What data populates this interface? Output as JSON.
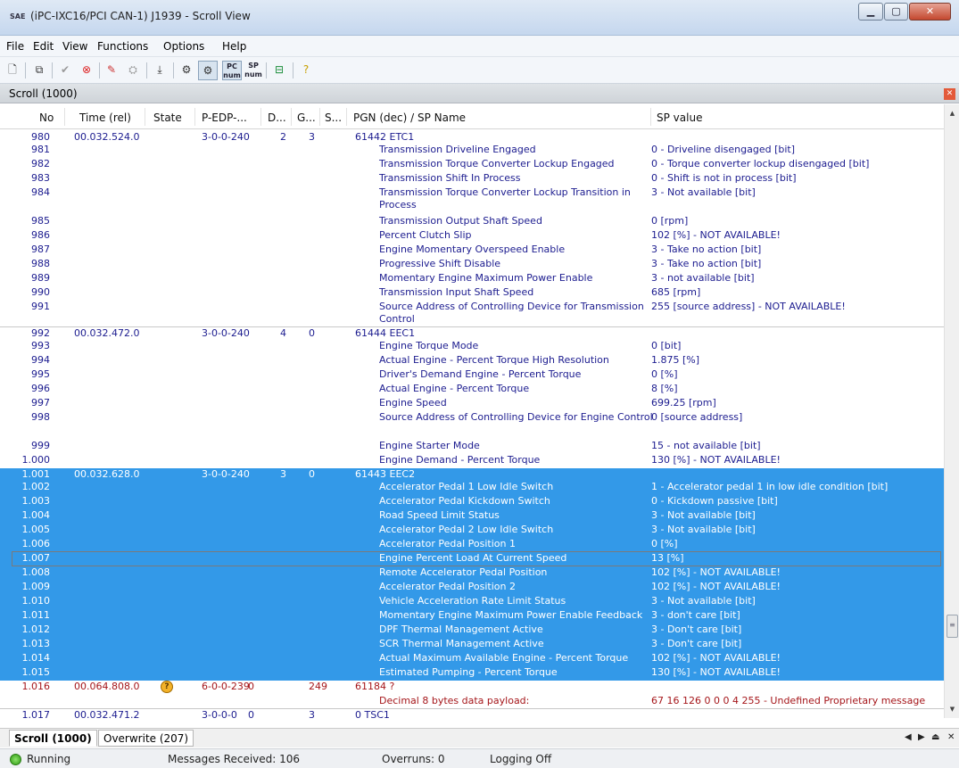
{
  "window": {
    "title": "(iPC-IXC16/PCI CAN-1) J1939 - Scroll View",
    "app_icon": "SAE"
  },
  "menu": [
    "File",
    "Edit",
    "View",
    "Functions",
    "Options",
    "Help"
  ],
  "toolbar": {
    "pc_num": "PC num",
    "sp_num": "SP num"
  },
  "pane": {
    "title": "Scroll (1000)"
  },
  "columns": [
    "No",
    "Time (rel)",
    "State",
    "P-EDP-...",
    "D...",
    "G...",
    "S...",
    "PGN (dec) / SP Name",
    "SP value"
  ],
  "rows": [
    {
      "no": "980",
      "time": "00.032.524.0",
      "state": "",
      "pedp": "3-0-0-240",
      "d": "",
      "g": "2",
      "s": "3",
      "name": "61442  ETC1",
      "value": "",
      "h": 14,
      "group": "a"
    },
    {
      "no": "981",
      "name": "Transmission Driveline Engaged",
      "value": "0 - Driveline disengaged [bit]",
      "h": 16,
      "group": "a"
    },
    {
      "no": "982",
      "name": "Transmission Torque Converter Lockup Engaged",
      "value": "0 - Torque converter lockup disengaged [bit]",
      "h": 16,
      "group": "a"
    },
    {
      "no": "983",
      "name": "Transmission Shift In Process",
      "value": "0 - Shift is not in process [bit]",
      "h": 16,
      "group": "a"
    },
    {
      "no": "984",
      "name": "Transmission Torque Converter Lockup Transition in Process",
      "value": "3 - Not available [bit]",
      "h": 32,
      "group": "a"
    },
    {
      "no": "985",
      "name": "Transmission Output Shaft Speed",
      "value": "0 [rpm]",
      "h": 16,
      "group": "a"
    },
    {
      "no": "986",
      "name": "Percent Clutch Slip",
      "value": "102 [%] - NOT AVAILABLE!",
      "h": 16,
      "group": "a"
    },
    {
      "no": "987",
      "name": "Engine Momentary Overspeed Enable",
      "value": "3 - Take no action [bit]",
      "h": 16,
      "group": "a"
    },
    {
      "no": "988",
      "name": "Progressive Shift Disable",
      "value": "3 - Take no action [bit]",
      "h": 16,
      "group": "a"
    },
    {
      "no": "989",
      "name": "Momentary Engine Maximum Power Enable",
      "value": "3 - not available [bit]",
      "h": 16,
      "group": "a"
    },
    {
      "no": "990",
      "name": "Transmission Input Shaft Speed",
      "value": "685 [rpm]",
      "h": 16,
      "group": "a"
    },
    {
      "no": "991",
      "name": "Source Address of Controlling Device for Transmission Control",
      "value": "255 [source address] - NOT AVAILABLE!",
      "h": 30,
      "group": "a"
    },
    {
      "no": "992",
      "time": "00.032.472.0",
      "state": "",
      "pedp": "3-0-0-240",
      "d": "",
      "g": "4",
      "s": "0",
      "name": "61444  EEC1",
      "value": "",
      "h": 14,
      "group": "b"
    },
    {
      "no": "993",
      "name": "Engine Torque Mode",
      "value": "0 [bit]",
      "h": 16,
      "group": "b"
    },
    {
      "no": "994",
      "name": "Actual Engine - Percent Torque High Resolution",
      "value": "1.875 [%]",
      "h": 16,
      "group": "b"
    },
    {
      "no": "995",
      "name": "Driver's Demand Engine - Percent Torque",
      "value": "0 [%]",
      "h": 16,
      "group": "b"
    },
    {
      "no": "996",
      "name": "Actual Engine - Percent Torque",
      "value": "8 [%]",
      "h": 16,
      "group": "b"
    },
    {
      "no": "997",
      "name": "Engine Speed",
      "value": "699.25 [rpm]",
      "h": 16,
      "group": "b"
    },
    {
      "no": "998",
      "name": "Source Address of Controlling Device for Engine Control",
      "value": "0 [source address]",
      "h": 32,
      "group": "b"
    },
    {
      "no": "999",
      "name": "Engine Starter Mode",
      "value": "15 - not available [bit]",
      "h": 16,
      "group": "b"
    },
    {
      "no": "1.000",
      "name": "Engine Demand - Percent Torque",
      "value": "130 [%] - NOT AVAILABLE!",
      "h": 16,
      "group": "b"
    },
    {
      "no": "1.001",
      "time": "00.032.628.0",
      "state": "",
      "pedp": "3-0-0-240",
      "d": "",
      "g": "3",
      "s": "0",
      "name": "61443  EEC2",
      "value": "",
      "h": 14,
      "group": "sel"
    },
    {
      "no": "1.002",
      "name": "Accelerator Pedal 1 Low Idle Switch",
      "value": "1 - Accelerator pedal 1 in low idle condition [bit]",
      "h": 16,
      "group": "sel"
    },
    {
      "no": "1.003",
      "name": "Accelerator Pedal Kickdown Switch",
      "value": "0 - Kickdown passive [bit]",
      "h": 16,
      "group": "sel"
    },
    {
      "no": "1.004",
      "name": "Road Speed Limit Status",
      "value": "3 - Not available [bit]",
      "h": 16,
      "group": "sel"
    },
    {
      "no": "1.005",
      "name": "Accelerator Pedal 2 Low Idle Switch",
      "value": "3 - Not available [bit]",
      "h": 16,
      "group": "sel"
    },
    {
      "no": "1.006",
      "name": "Accelerator Pedal Position 1",
      "value": "0 [%]",
      "h": 16,
      "group": "sel"
    },
    {
      "no": "1.007",
      "name": "Engine Percent Load At Current Speed",
      "value": "13 [%]",
      "h": 16,
      "group": "sel",
      "focus": true
    },
    {
      "no": "1.008",
      "name": "Remote Accelerator Pedal Position",
      "value": "102 [%] - NOT AVAILABLE!",
      "h": 16,
      "group": "sel"
    },
    {
      "no": "1.009",
      "name": "Accelerator Pedal Position 2",
      "value": "102 [%] - NOT AVAILABLE!",
      "h": 16,
      "group": "sel"
    },
    {
      "no": "1.010",
      "name": "Vehicle Acceleration Rate Limit Status",
      "value": "3 - Not available [bit]",
      "h": 16,
      "group": "sel"
    },
    {
      "no": "1.011",
      "name": "Momentary Engine Maximum Power Enable Feedback",
      "value": "3 - don't care [bit]",
      "h": 16,
      "group": "sel"
    },
    {
      "no": "1.012",
      "name": "DPF Thermal Management Active",
      "value": "3 - Don't care [bit]",
      "h": 16,
      "group": "sel"
    },
    {
      "no": "1.013",
      "name": "SCR Thermal Management Active",
      "value": "3 - Don't care [bit]",
      "h": 16,
      "group": "sel"
    },
    {
      "no": "1.014",
      "name": "Actual Maximum Available Engine - Percent Torque",
      "value": "102 [%] - NOT AVAILABLE!",
      "h": 16,
      "group": "sel"
    },
    {
      "no": "1.015",
      "name": "Estimated Pumping - Percent Torque",
      "value": "130 [%] - NOT AVAILABLE!",
      "h": 16,
      "group": "sel"
    },
    {
      "no": "1.016",
      "time": "00.064.808.0",
      "state": "?",
      "pedp": "6-0-0-239",
      "d": "0",
      "g": "",
      "s": "249",
      "name": "61184  ?",
      "value": "",
      "h": 16,
      "group": "red"
    },
    {
      "no": "",
      "name": "Decimal 8 bytes data payload:",
      "value": "67 16 126 0 0 0 4 255   - Undefined Proprietary message",
      "h": 16,
      "group": "red"
    },
    {
      "no": "1.017",
      "time": "00.032.471.2",
      "state": "",
      "pedp": "3-0-0-0",
      "d": "0",
      "g": "",
      "s": "3",
      "name": "0  TSC1",
      "value": "",
      "h": 14,
      "group": "b"
    }
  ],
  "tabs": [
    "Scroll (1000)",
    "Overwrite (207)"
  ],
  "status": {
    "state": "Running",
    "messages": "Messages Received: 106",
    "overruns": "Overruns: 0",
    "logging": "Logging Off"
  }
}
